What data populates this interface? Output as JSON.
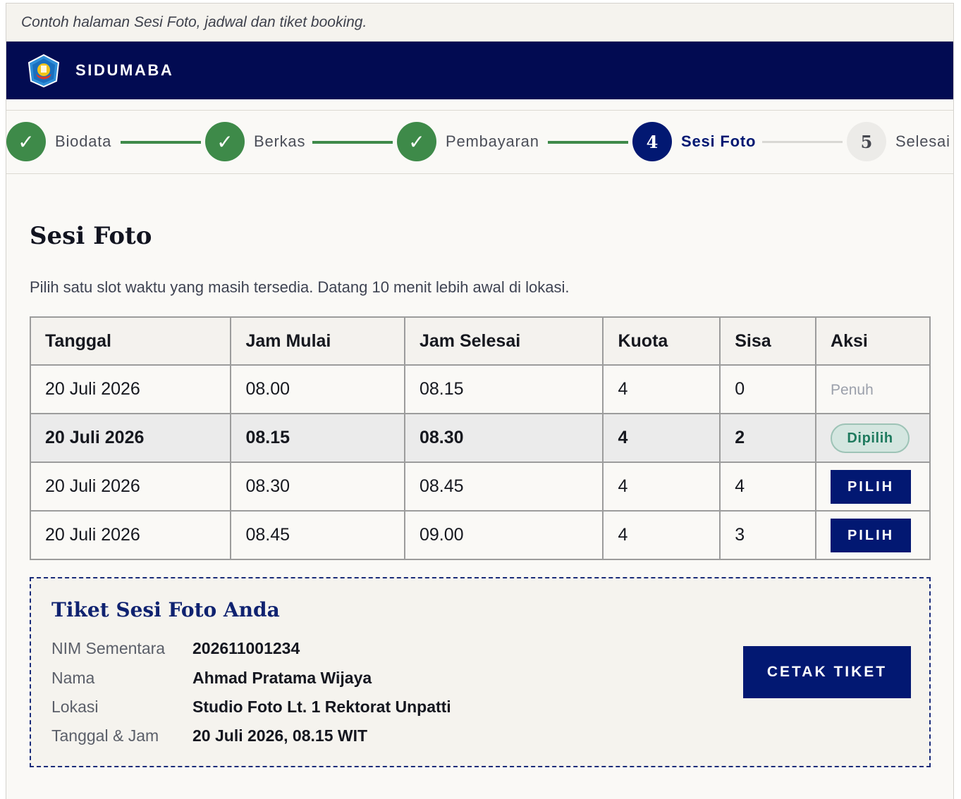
{
  "caption": "Contoh halaman Sesi Foto, jadwal dan tiket booking.",
  "header": {
    "brand": "SIDUMABA",
    "logo_icon": "university-crest-icon"
  },
  "stepper": {
    "steps": [
      {
        "marker": "✓",
        "label": "Biodata",
        "state": "done"
      },
      {
        "marker": "✓",
        "label": "Berkas",
        "state": "done"
      },
      {
        "marker": "✓",
        "label": "Pembayaran",
        "state": "done"
      },
      {
        "marker": "4",
        "label": "Sesi Foto",
        "state": "active"
      },
      {
        "marker": "5",
        "label": "Selesai",
        "state": "todo"
      }
    ]
  },
  "page": {
    "title": "Sesi Foto",
    "intro": "Pilih satu slot waktu yang masih tersedia. Datang 10 menit lebih awal di lokasi."
  },
  "table": {
    "headers": [
      "Tanggal",
      "Jam Mulai",
      "Jam Selesai",
      "Kuota",
      "Sisa",
      "Aksi"
    ],
    "rows": [
      {
        "tanggal": "20 Juli 2026",
        "mulai": "08.00",
        "selesai": "08.15",
        "kuota": "4",
        "sisa": "0",
        "aksi": "Penuh"
      },
      {
        "tanggal": "20 Juli 2026",
        "mulai": "08.15",
        "selesai": "08.30",
        "kuota": "4",
        "sisa": "2",
        "aksi": "Dipilih"
      },
      {
        "tanggal": "20 Juli 2026",
        "mulai": "08.30",
        "selesai": "08.45",
        "kuota": "4",
        "sisa": "4",
        "aksi": "PILIH"
      },
      {
        "tanggal": "20 Juli 2026",
        "mulai": "08.45",
        "selesai": "09.00",
        "kuota": "4",
        "sisa": "3",
        "aksi": "PILIH"
      }
    ]
  },
  "ticket": {
    "title": "Tiket Sesi Foto Anda",
    "fields": [
      {
        "label": "NIM Sementara",
        "value": "202611001234"
      },
      {
        "label": "Nama",
        "value": "Ahmad Pratama Wijaya"
      },
      {
        "label": "Lokasi",
        "value": "Studio Foto Lt. 1 Rektorat Unpatti"
      },
      {
        "label": "Tanggal & Jam",
        "value": "20 Juli 2026, 08.15 WIT"
      }
    ],
    "print_label": "CETAK TIKET"
  },
  "colors": {
    "navy": "#021872",
    "header_navy": "#020b52",
    "success_green": "#3e8a49",
    "selected_teal": "#1e7a5e"
  }
}
